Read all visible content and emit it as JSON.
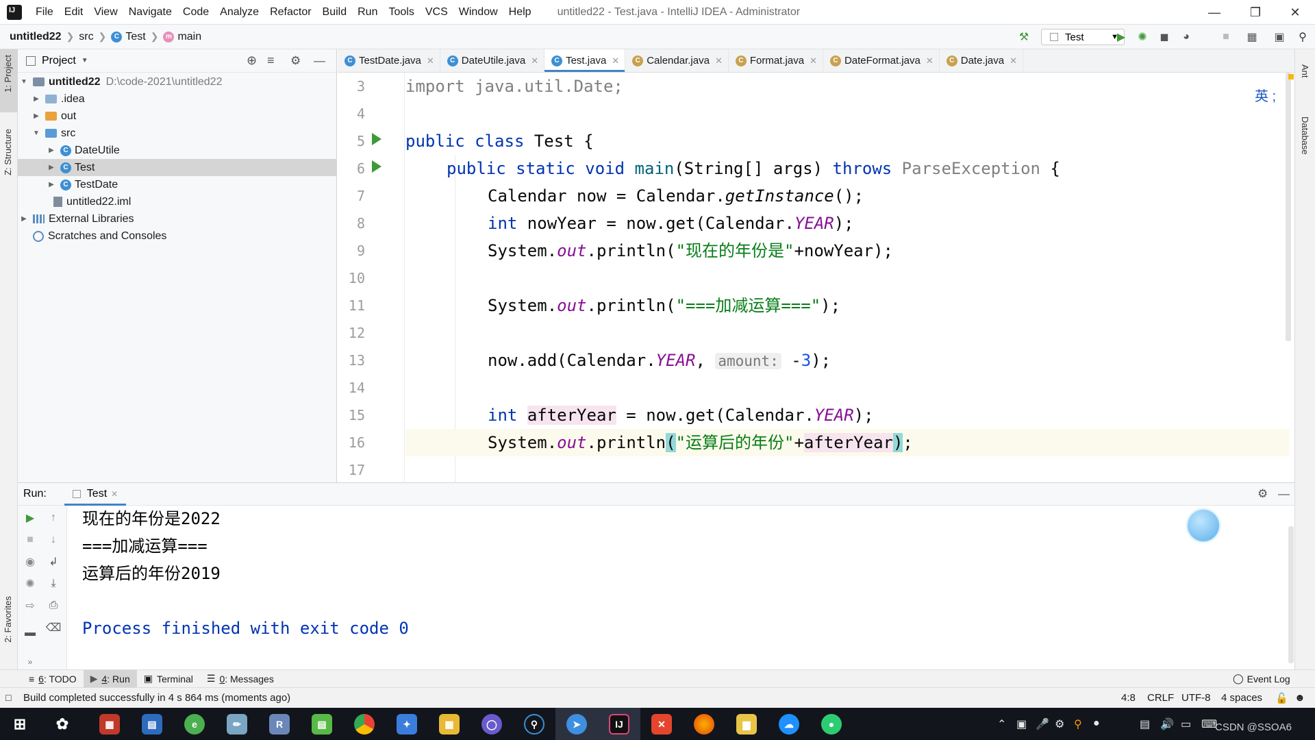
{
  "menubar": {
    "items": [
      "File",
      "Edit",
      "View",
      "Navigate",
      "Code",
      "Analyze",
      "Refactor",
      "Build",
      "Run",
      "Tools",
      "VCS",
      "Window",
      "Help"
    ],
    "window_title": "untitled22 - Test.java - IntelliJ IDEA - Administrator"
  },
  "navbar": {
    "crumbs": [
      "untitled22",
      "src",
      "Test",
      "main"
    ],
    "run_config": "Test"
  },
  "project": {
    "header": "Project",
    "tree": [
      {
        "label": "untitled22",
        "extra": "D:\\code-2021\\untitled22"
      },
      {
        "label": ".idea"
      },
      {
        "label": "out"
      },
      {
        "label": "src"
      },
      {
        "label": "DateUtile"
      },
      {
        "label": "Test"
      },
      {
        "label": "TestDate"
      },
      {
        "label": "untitled22.iml"
      },
      {
        "label": "External Libraries"
      },
      {
        "label": "Scratches and Consoles"
      }
    ]
  },
  "tool_stripe": {
    "project": "1: Project",
    "structure": "Z: Structure",
    "favorites": "2: Favorites",
    "ant": "Ant",
    "database": "Database"
  },
  "tabs": [
    "TestDate.java",
    "DateUtile.java",
    "Test.java",
    "Calendar.java",
    "Format.java",
    "DateFormat.java",
    "Date.java"
  ],
  "active_tab": "Test.java",
  "editor": {
    "line_numbers": [
      "3",
      "4",
      "5",
      "6",
      "7",
      "8",
      "9",
      "10",
      "11",
      "12",
      "13",
      "14",
      "15",
      "16",
      "17"
    ],
    "ime": "英 ;",
    "code": {
      "l3": "import java.util.Date;",
      "l5_kw": "public class",
      "l5_name": " Test {",
      "l6_kw": "public static void",
      "l6_fn": "main",
      "l6_args": "(String[] args) ",
      "l6_throws": "throws",
      "l6_ex": " ParseException",
      "l6_end": " {",
      "l7_a": "Calendar now = Calendar.",
      "l7_fn": "getInstance",
      "l7_b": "();",
      "l8_kw": "int",
      "l8_a": " nowYear = now.get(Calendar.",
      "l8_sf": "YEAR",
      "l8_b": ");",
      "l9_a": "System.",
      "l9_sf": "out",
      "l9_b": ".println(",
      "l9_str": "\"现在的年份是\"",
      "l9_c": "+nowYear);",
      "l11_a": "System.",
      "l11_sf": "out",
      "l11_b": ".println(",
      "l11_str": "\"===加减运算===\"",
      "l11_c": ");",
      "l13_a": "now.add(Calendar.",
      "l13_sf": "YEAR",
      "l13_b": ", ",
      "l13_hint": "amount:",
      "l13_c": " -",
      "l13_num": "3",
      "l13_d": ");",
      "l15_kw": "int",
      "l15_var": "afterYear",
      "l15_a": " = now.get(Calendar.",
      "l15_sf": "YEAR",
      "l15_b": ");",
      "l16_a": "System.",
      "l16_sf": "out",
      "l16_b": ".println",
      "l16_p1": "(",
      "l16_str": "\"运算后的年份\"",
      "l16_c": "+",
      "l16_var": "afterYear",
      "l16_p2": ")",
      "l16_d": ";"
    }
  },
  "run_panel": {
    "label": "Run:",
    "tab": "Test",
    "output": [
      "现在的年份是2022",
      "===加减运算===",
      "运算后的年份2019",
      "",
      "Process finished with exit code 0"
    ]
  },
  "bottom_tools": {
    "todo_num": "6",
    "todo": ": TODO",
    "run_num": "4",
    "run": ": Run",
    "terminal": "Terminal",
    "messages_num": "0",
    "messages": ": Messages",
    "event_log": "Event Log"
  },
  "status": {
    "message": "Build completed successfully in 4 s 864 ms (moments ago)",
    "position": "4:8",
    "line_sep": "CRLF",
    "encoding": "UTF-8",
    "indent": "4 spaces"
  },
  "taskbar": {
    "watermark": "CSDN @SSOA6"
  },
  "colors": {
    "keyword": "#0033b3",
    "string": "#067d17",
    "static_field": "#871094",
    "accent": "#4083c9",
    "run_green": "#3e9a36"
  }
}
